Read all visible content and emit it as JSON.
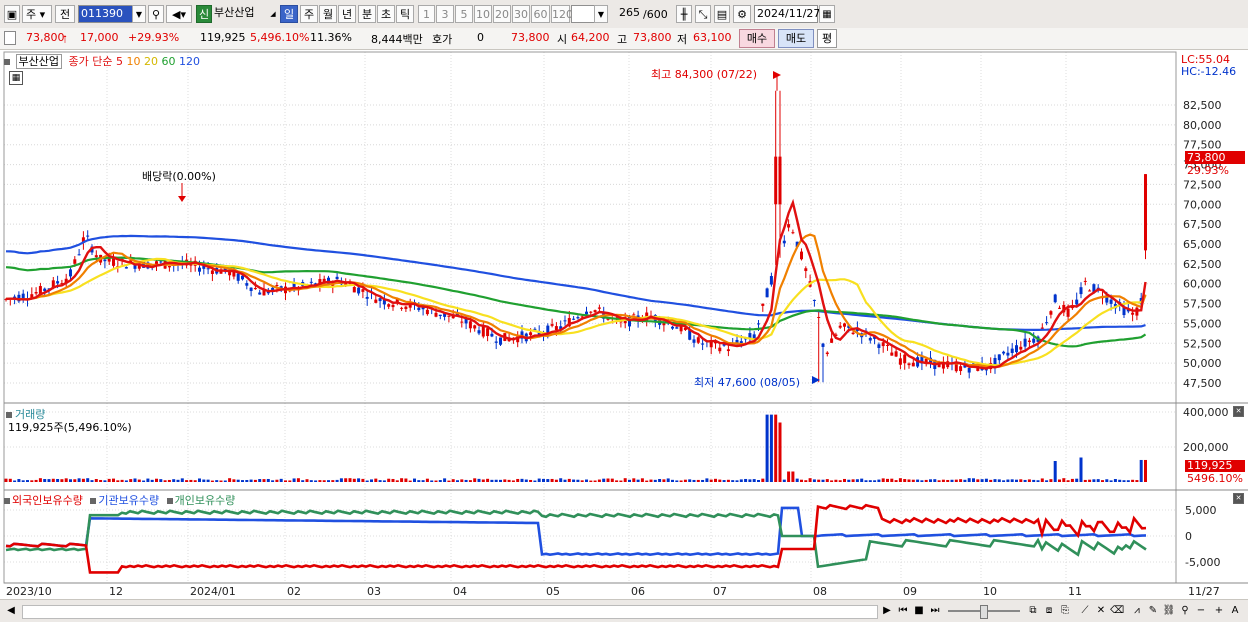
{
  "toolbar": {
    "period_label": "주",
    "prev_label": "전",
    "code": "011390",
    "badge": "신",
    "stock_name": "부산산업",
    "tabs": [
      "일",
      "주",
      "월",
      "년",
      "분",
      "초",
      "틱"
    ],
    "active_tab": "일",
    "intervals": [
      "1",
      "3",
      "5",
      "10",
      "20",
      "30",
      "60",
      "120"
    ],
    "count": "265",
    "count_total": "/600",
    "date": "2024/11/27"
  },
  "quote": {
    "price": "73,800",
    "change": "17,000",
    "change_pct": "+29.93%",
    "volume": "119,925",
    "volume_pct": "5,496.10%",
    "turnover_pct": "11.36%",
    "amount": "8,444백만",
    "hoga_label": "호가",
    "hoga_value": "0",
    "hoga_price": "73,800",
    "open_label": "시",
    "open": "64,200",
    "high_label": "고",
    "high": "73,800",
    "low_label": "저",
    "low": "63,100",
    "buy_label": "매수",
    "sell_label": "매도",
    "avg_label": "평"
  },
  "price_panel": {
    "legend_name": "부산산업",
    "legend_close": "종가",
    "legend_type": "단순",
    "ma_labels": [
      "5",
      "10",
      "20",
      "60",
      "120"
    ],
    "lc": "LC:55.04",
    "hc": "HC:-12.46",
    "y_ticks": [
      "82,500",
      "80,000",
      "77,500",
      "75,000",
      "72,500",
      "70,000",
      "67,500",
      "65,000",
      "62,500",
      "60,000",
      "57,500",
      "55,000",
      "52,500",
      "50,000",
      "47,500"
    ],
    "current_price_tag": "73,800",
    "current_pct_tag": "29.93%",
    "high_annotation": "최고 84,300 (07/22)",
    "low_annotation": "최저 47,600 (08/05)",
    "dividend_annotation": "배당락(0.00%)"
  },
  "volume_panel": {
    "title": "거래량",
    "subtitle": "119,925주(5,496.10%)",
    "y_ticks": [
      "400,000",
      "200,000"
    ],
    "current_tag": "119,925",
    "current_pct": "5496.10%"
  },
  "holdings_panel": {
    "legend": [
      "외국인보유수량",
      "기관보유수량",
      "개인보유수량"
    ],
    "y_ticks": [
      "5,000",
      "0",
      "-5,000"
    ]
  },
  "x_axis": {
    "labels": [
      "2023/10",
      "12",
      "2024/01",
      "02",
      "03",
      "04",
      "05",
      "06",
      "07",
      "08",
      "09",
      "10",
      "11",
      "11/27"
    ]
  },
  "colors": {
    "ma5": "#e01010",
    "ma10": "#f08000",
    "ma20": "#f8e020",
    "ma60": "#20a030",
    "ma120": "#2050e0",
    "up": "#e00000",
    "down": "#0033cc",
    "foreign": "#e00000",
    "inst": "#2050e0",
    "indiv": "#30905a"
  }
}
